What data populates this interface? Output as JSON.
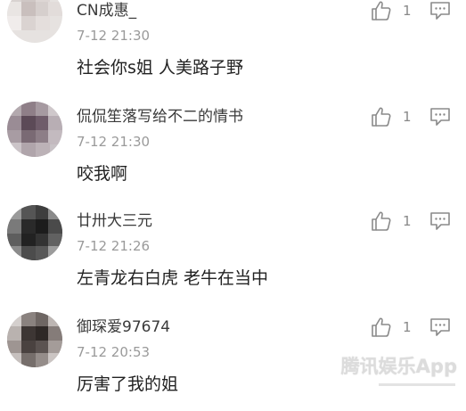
{
  "comments": [
    {
      "username": "CN成惠_",
      "time": "7-12 21:30",
      "text": "社会你s姐 人美路子野",
      "likes": "1"
    },
    {
      "username": "侃侃笙落写给不二的情书",
      "time": "7-12 21:30",
      "text": "咬我啊",
      "likes": "1"
    },
    {
      "username": "廿卅大三元",
      "time": "7-12 21:26",
      "text": "左青龙右白虎 老牛在当中",
      "likes": "1"
    },
    {
      "username": "御琛爱97674",
      "time": "7-12 20:53",
      "text": "厉害了我的姐",
      "likes": "1"
    }
  ],
  "watermark": {
    "brand": "腾讯娱乐App"
  },
  "icons": {
    "like": "thumbs-up-icon",
    "reply": "comment-bubble-icon"
  },
  "colors": {
    "username": "#3a3a3a",
    "time": "#9a9a9a",
    "text": "#222222",
    "icon": "#8a8a8a"
  }
}
